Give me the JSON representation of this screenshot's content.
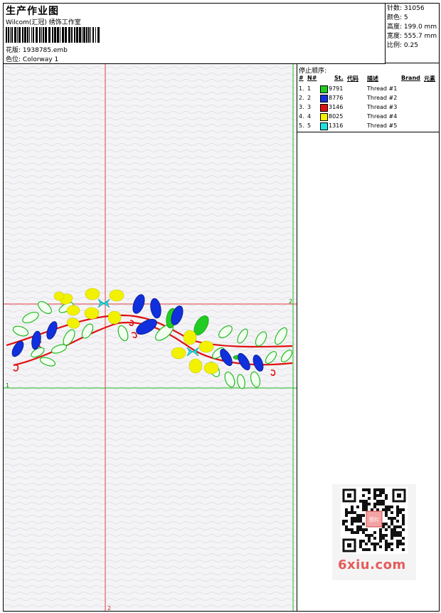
{
  "header": {
    "title": "生产作业图",
    "subtitle": "Wilcom(汇冠) 绣饰工作室",
    "design_label": "花版:",
    "design_value": "1938785.emb",
    "colorway_label": "色位:",
    "colorway_value": "Colorway 1"
  },
  "stats": {
    "stitches_label": "针数:",
    "stitches_value": "31056",
    "colors_label": "颜色:",
    "colors_value": "5",
    "height_label": "高度:",
    "height_value": "199.0 mm",
    "width_label": "宽度:",
    "width_value": "555.7 mm",
    "scale_label": "比例:",
    "scale_value": "0.25"
  },
  "threads": {
    "section_title": "停止顺序:",
    "headers": {
      "num": "#",
      "n": "N#",
      "st": "St.",
      "code": "代码",
      "desc": "描述",
      "brand": "Brand",
      "element": "元素"
    },
    "rows": [
      {
        "idx": "1.",
        "n": "1",
        "color": "#22cc22",
        "code": "9791",
        "desc": "Thread #1"
      },
      {
        "idx": "2.",
        "n": "2",
        "color": "#1030dd",
        "code": "8776",
        "desc": "Thread #2"
      },
      {
        "idx": "3.",
        "n": "3",
        "color": "#e01010",
        "code": "3146",
        "desc": "Thread #3"
      },
      {
        "idx": "4.",
        "n": "4",
        "color": "#f2f200",
        "code": "8025",
        "desc": "Thread #4"
      },
      {
        "idx": "5.",
        "n": "5",
        "color": "#20e0e0",
        "code": "1316",
        "desc": "Thread #5"
      }
    ]
  },
  "canvas": {
    "guide_label_1": "1",
    "guide_label_2": "2",
    "guide_label_z": "2",
    "colors": {
      "red_guide": "#e04040",
      "green_guide": "#22bb22"
    }
  },
  "watermark": {
    "text": "6xiu.com",
    "badge": "图片"
  }
}
